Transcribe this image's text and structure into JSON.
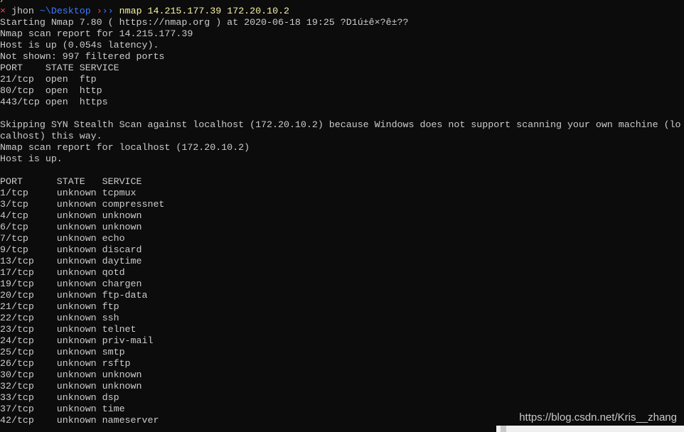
{
  "prompt": {
    "mark": "×",
    "user": "jhon",
    "dir": "~\\Desktop",
    "arrows1": "›",
    "arrows2": "››",
    "command": "nmap 14.215.177.39 172.20.10.2"
  },
  "prev_line": "/",
  "output": [
    "Starting Nmap 7.80 ( https://nmap.org ) at 2020-06-18 19:25 ?D1ú±ê×?ê±??",
    "Nmap scan report for 14.215.177.39",
    "Host is up (0.054s latency).",
    "Not shown: 997 filtered ports",
    "PORT    STATE SERVICE",
    "21/tcp  open  ftp",
    "80/tcp  open  http",
    "443/tcp open  https",
    "",
    "Skipping SYN Stealth Scan against localhost (172.20.10.2) because Windows does not support scanning your own machine (lo",
    "calhost) this way.",
    "Nmap scan report for localhost (172.20.10.2)",
    "Host is up.",
    "",
    "PORT      STATE   SERVICE",
    "1/tcp     unknown tcpmux",
    "3/tcp     unknown compressnet",
    "4/tcp     unknown unknown",
    "6/tcp     unknown unknown",
    "7/tcp     unknown echo",
    "9/tcp     unknown discard",
    "13/tcp    unknown daytime",
    "17/tcp    unknown qotd",
    "19/tcp    unknown chargen",
    "20/tcp    unknown ftp-data",
    "21/tcp    unknown ftp",
    "22/tcp    unknown ssh",
    "23/tcp    unknown telnet",
    "24/tcp    unknown priv-mail",
    "25/tcp    unknown smtp",
    "26/tcp    unknown rsftp",
    "30/tcp    unknown unknown",
    "32/tcp    unknown unknown",
    "33/tcp    unknown dsp",
    "37/tcp    unknown time",
    "42/tcp    unknown nameserver"
  ],
  "watermark": "https://blog.csdn.net/Kris__zhang"
}
